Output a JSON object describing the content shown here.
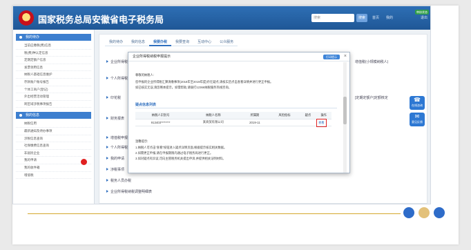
{
  "header": {
    "site_title": "国家税务总局安徽省电子税务局",
    "search_placeholder": "搜索",
    "search_button": "搜索",
    "links": [
      "首页",
      "我的",
      "退出"
    ],
    "badge": "审核状态",
    "brand_colors": {
      "header": "#2e6fb5",
      "accent": "#3d7fcf",
      "alert": "#e02020"
    }
  },
  "sidebar": {
    "section1": "我的待办",
    "items1": [
      "当前应缴税(费)信息",
      "税(费)种认定信息",
      "定期定额户信息",
      "发票领用信息",
      "纳税人基础信息维护",
      "存款账户账号报告",
      "个体工商户(登记)",
      "外出经营活动管理",
      "跨区域涉税事项报告"
    ],
    "section2": "我的信息",
    "items2": [
      "纳税信用",
      "最新通知及待办事项",
      "涉税信息查询",
      "社保缴费信息查询",
      "非居民企业",
      "我的申请",
      "我的收件箱",
      "增值税"
    ]
  },
  "tabs": [
    "我的待办",
    "我的信息",
    "我要办税",
    "我要查询",
    "互动中心",
    "公众服务"
  ],
  "main_lines": [
    "企业所得税申报",
    "个人所得税",
    "印花税",
    "财务报表",
    "增值税申报",
    "个人所得税申报",
    "我的申请",
    "涉税事项",
    "税务人员办税",
    "企业所得税纳税调整明细表"
  ],
  "right_notes": [
    "增值税(小规模纳税人)",
    "[定期定额户]定额核定"
  ],
  "float_buttons": [
    {
      "label": "在线咨询",
      "icon": "headset-icon"
    },
    {
      "label": "意见反馈",
      "icon": "chat-icon"
    }
  ],
  "modal": {
    "title": "企业所得税纳税申报提示",
    "badge": "打印提示",
    "greeting": "尊敬的纳税人:",
    "body_lines": [
      "您申报的企业所得税汇算清缴事项(2018年至2019年度)存在疑点,请核实后点击查看详情并进行更正申报。",
      "如已核实无误,请忽略本提示。如需帮助,请拨打12366纳税服务热线咨询。"
    ],
    "section_title": "疑点信息列表",
    "table": {
      "headers": [
        "纳税人识别号",
        "纳税人名称",
        "所属期",
        "风险指标",
        "疑点",
        "操作"
      ],
      "rows": [
        [
          "913403********",
          "某商贸有限公司",
          "2019-11",
          "",
          "",
          "查看"
        ]
      ]
    },
    "notes_title": "温馨提示:",
    "notes": [
      "1.纳税人可点击“查看”按钮进入疑点详情页面,根据提示核实相关数据。",
      "2.如需更正申报,请在申报期限内通过电子税务局进行更正。",
      "3.如对疑点有异议,可向主管税务机关提出申诉,并提供相关证明材料。"
    ]
  }
}
